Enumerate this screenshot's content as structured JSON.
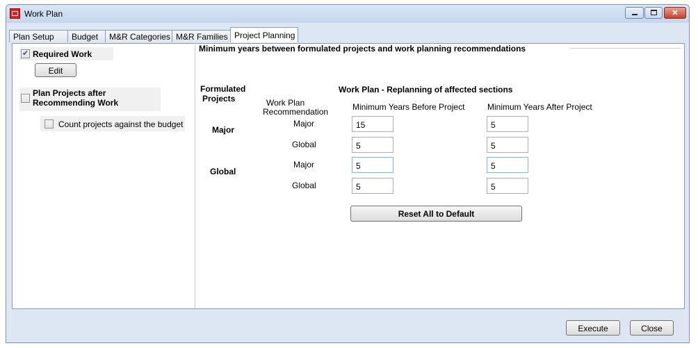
{
  "window": {
    "title": "Work Plan"
  },
  "tabs": [
    "Plan Setup",
    "Budget",
    "M&R Categories",
    "M&R Families",
    "Project Planning"
  ],
  "left": {
    "required_work": {
      "label": "Required Work",
      "checked": true
    },
    "edit_button": "Edit",
    "plan_projects": {
      "label_line1": "Plan Projects after",
      "label_line2": "Recommending Work",
      "checked": false
    },
    "count_projects": {
      "label": "Count projects against the budget",
      "checked": false
    }
  },
  "group": {
    "title": "Minimum years between formulated projects and work planning recommendations",
    "formulated_line1": "Formulated",
    "formulated_line2": "Projects",
    "replanning_header": "Work Plan - Replanning of affected sections",
    "rec_line1": "Work Plan",
    "rec_line2": "Recommendation",
    "col_before": "Minimum Years Before Project",
    "col_after": "Minimum Years After Project",
    "rows": [
      {
        "project": "Major",
        "recommendation": "Major",
        "before": "15",
        "after": "5"
      },
      {
        "project": "",
        "recommendation": "Global",
        "before": "5",
        "after": "5"
      },
      {
        "project": "Global",
        "recommendation": "Major",
        "before": "5",
        "after": "5"
      },
      {
        "project": "",
        "recommendation": "Global",
        "before": "5",
        "after": "5"
      }
    ],
    "reset_button": "Reset All to Default"
  },
  "footer": {
    "execute": "Execute",
    "close": "Close"
  }
}
